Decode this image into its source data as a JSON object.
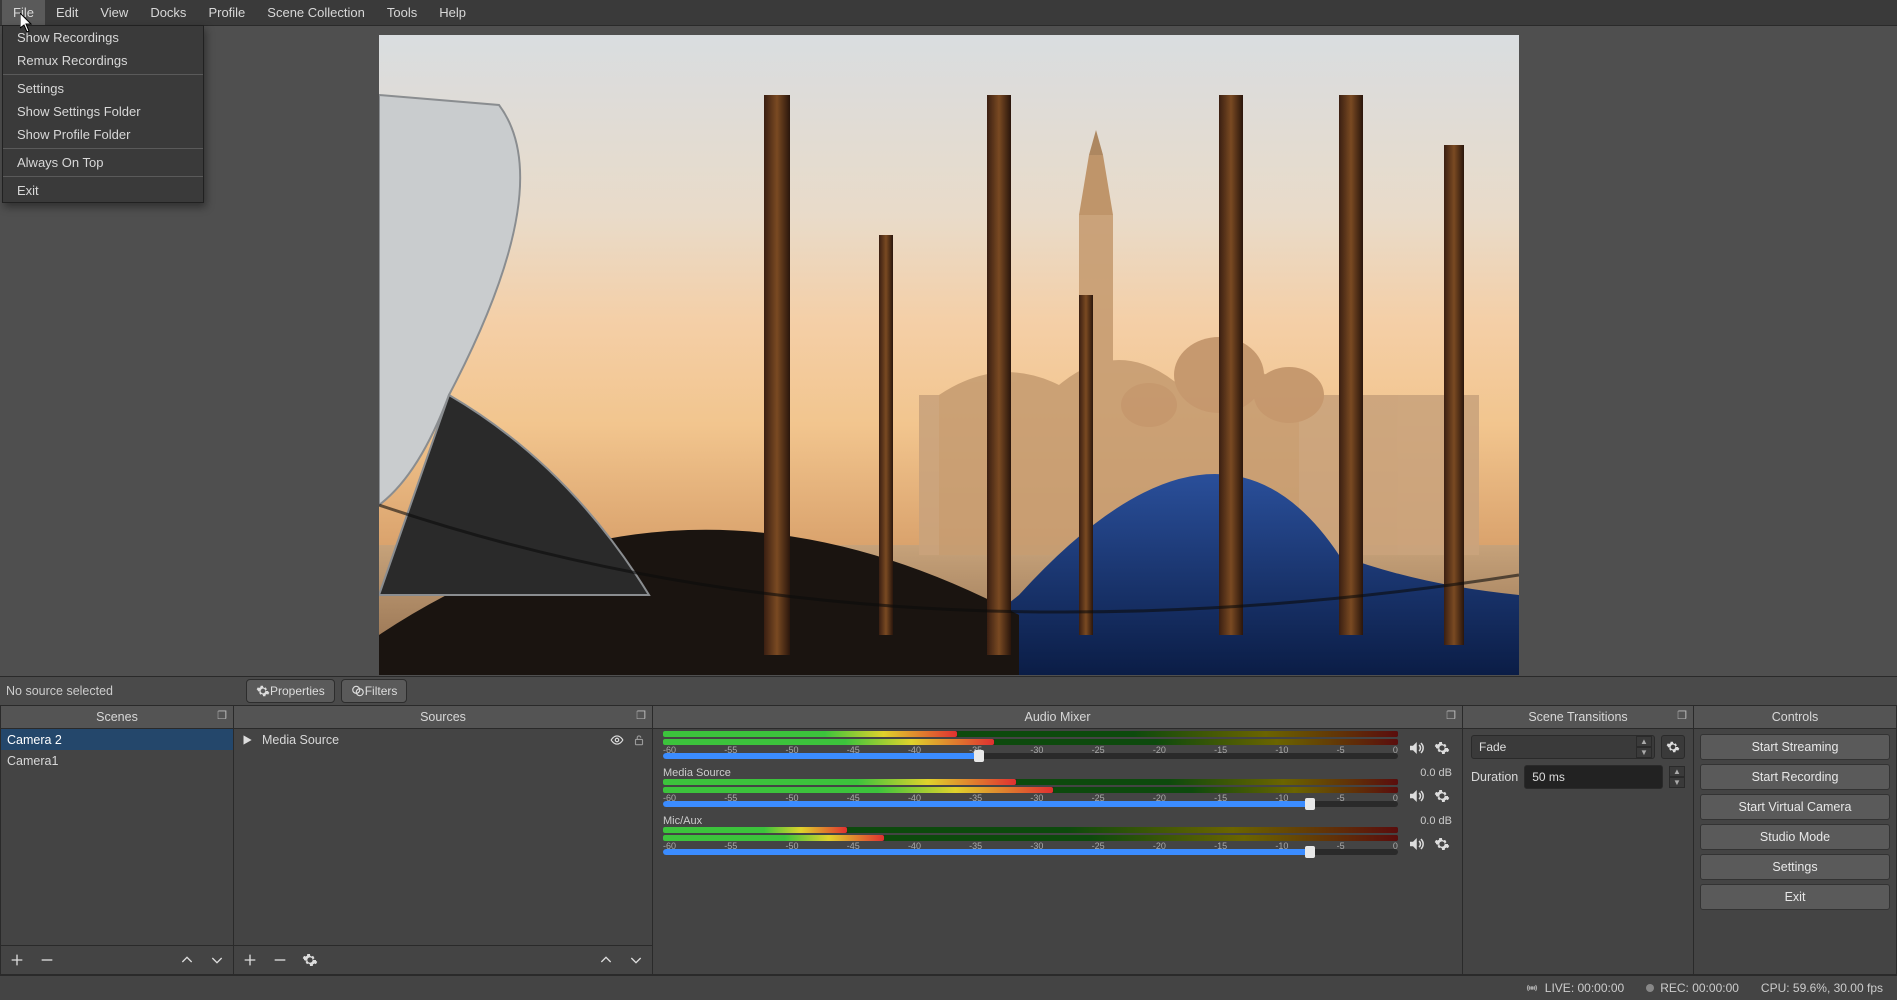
{
  "menubar": {
    "items": [
      "File",
      "Edit",
      "View",
      "Docks",
      "Profile",
      "Scene Collection",
      "Tools",
      "Help"
    ]
  },
  "file_menu": {
    "g1": [
      "Show Recordings",
      "Remux Recordings"
    ],
    "g2": [
      "Settings",
      "Show Settings Folder",
      "Show Profile Folder"
    ],
    "g3": [
      "Always On Top"
    ],
    "g4": [
      "Exit"
    ]
  },
  "status_row": {
    "left": "No source selected",
    "properties": "Properties",
    "filters": "Filters"
  },
  "panels": {
    "scenes": "Scenes",
    "sources": "Sources",
    "mixer": "Audio Mixer",
    "transitions": "Scene Transitions",
    "controls": "Controls"
  },
  "scenes": [
    "Camera 2",
    "Camera1"
  ],
  "sources": [
    {
      "name": "Media Source"
    }
  ],
  "mixer": {
    "ticks": [
      "-60",
      "-55",
      "-50",
      "-45",
      "-40",
      "-35",
      "-30",
      "-25",
      "-20",
      "-15",
      "-10",
      "-5",
      "0"
    ],
    "tracks": [
      {
        "label": "",
        "db": "",
        "level": 0.4,
        "slider": 0.43
      },
      {
        "label": "Media Source",
        "db": "0.0 dB",
        "level": 0.48,
        "slider": 0.88
      },
      {
        "label": "Mic/Aux",
        "db": "0.0 dB",
        "level": 0.25,
        "slider": 0.88
      }
    ]
  },
  "transitions": {
    "type": "Fade",
    "duration_label": "Duration",
    "duration": "50 ms"
  },
  "controls": [
    "Start Streaming",
    "Start Recording",
    "Start Virtual Camera",
    "Studio Mode",
    "Settings",
    "Exit"
  ],
  "statusbar": {
    "live": "LIVE: 00:00:00",
    "rec": "REC: 00:00:00",
    "cpu": "CPU: 59.6%, 30.00 fps"
  }
}
